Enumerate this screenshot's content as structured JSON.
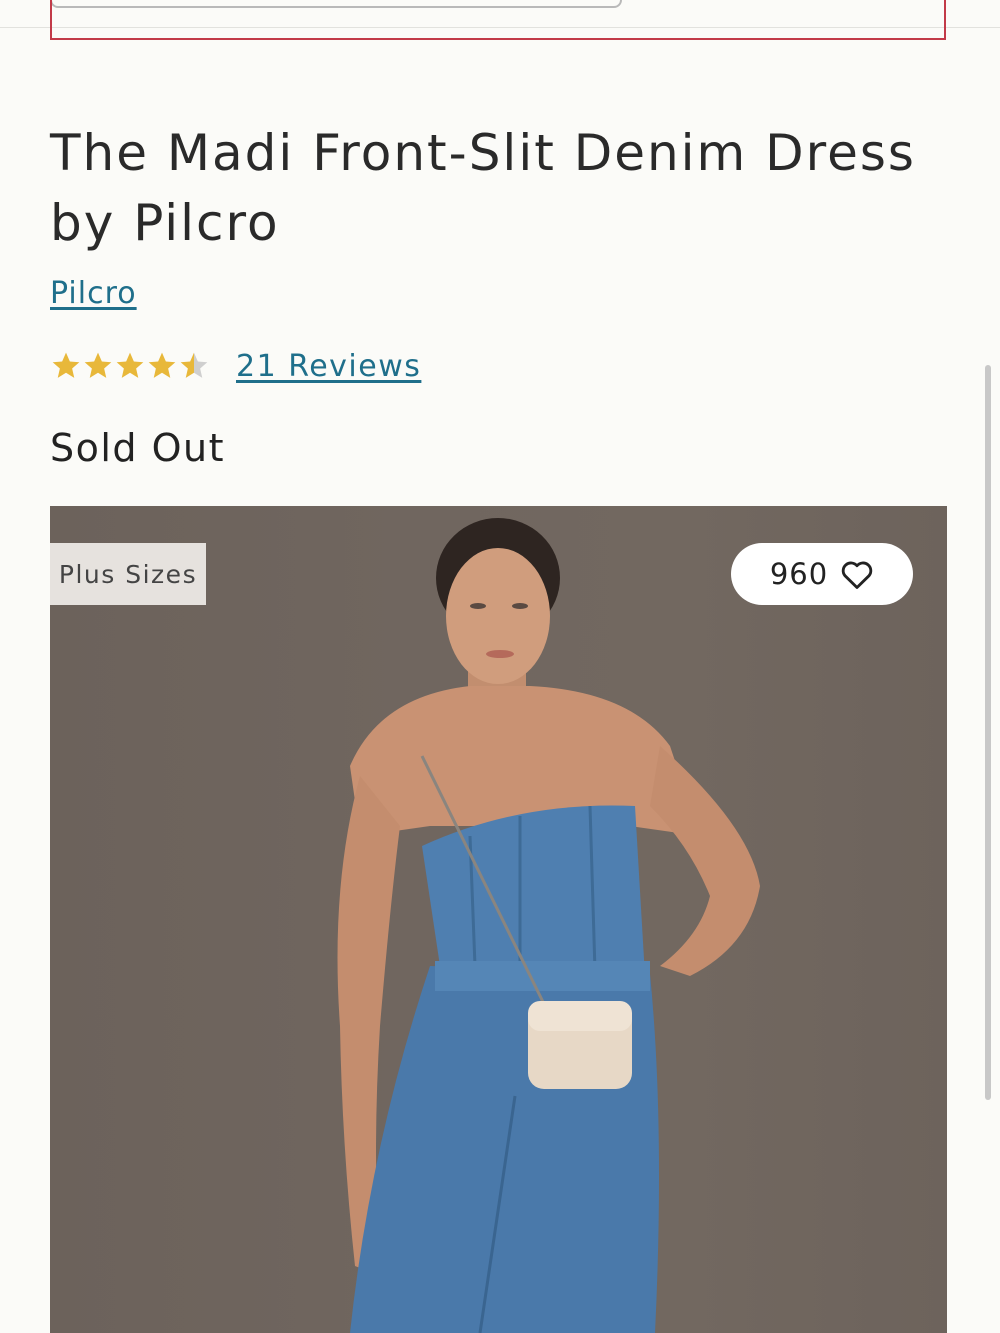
{
  "product": {
    "title": "The Madi Front-Slit Denim Dress by Pilcro",
    "brand": "Pilcro",
    "rating": 4.5,
    "rating_max": 5,
    "reviews_label": "21 Reviews",
    "price_status": "Sold Out"
  },
  "image": {
    "badge": "Plus Sizes",
    "favorites_count": "960",
    "alt": "Model wearing a strapless denim midi dress with a front slit and a beaded crossbody bag"
  },
  "icons": {
    "star": "star-icon",
    "heart": "heart-icon"
  },
  "colors": {
    "link": "#1f6f8b",
    "star_filled": "#e8b83a",
    "star_empty": "#cfcfcf",
    "alert_border": "#c23a48"
  }
}
